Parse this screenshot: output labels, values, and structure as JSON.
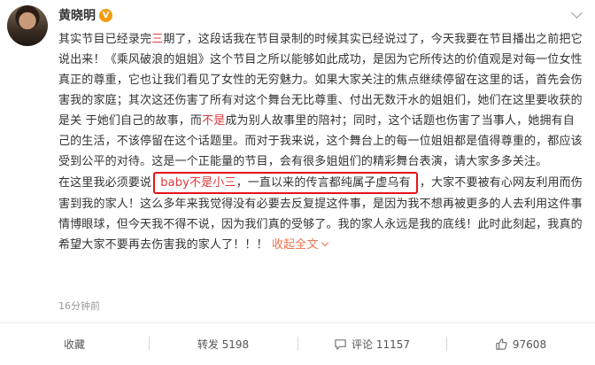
{
  "author": {
    "name": "黄晓明",
    "verified_badge": "V"
  },
  "post": {
    "p1_a": "其实节目已经录完",
    "p1_red": "三",
    "p1_b": "期了，这段话我在节目录制的时候其实已经说过了，今天我要在节目播出之前把它说出来！《乘风破浪的姐姐》这个节目之所以能够如此成功，是因为它所传达的价值观是对每一位女性真正的尊重，它也让我们看见了女性的无穷魅力。如果大家关注的焦点继续停留在这里的话，首先会伤害我的家庭；其次这还伤害了所有对这个舞台无比尊重、付出无数汗水的姐姐们，她们在这里要收获的是关 于她们自己的故事，而",
    "p1_red2": "不是",
    "p1_c": "成为别人故事里的陪衬；同时，这个话题也伤害了当事人，她拥有自己的生活，不该停留在这个话题里。而对于我来说，这个舞台上的每一位姐姐都是值得尊重的，都应该受到公平的对待。这是一个正能量的节目，会有很多姐姐们的精彩舞台表演，请大家多多关注。",
    "p2_a": "在这里我必须要说",
    "p2_red": "baby不是小三",
    "p2_highlight_rest": "，一直以来的传言都纯属子虚乌有",
    "p2_b": "，大家不要被有心网友利用而伤害到我的家人！这么多年来我觉得没有必要去反复提这件事，是因为我不想再被更多的人去利用这件事情博眼球，但今天我不得不说，因为我们真的受够了。我的家人永远是我的底线！此时此刻起，我真的希望大家不要再去伤害我的家人了！！！",
    "expand_label": "收起全文"
  },
  "meta": {
    "timestamp": "16分钟前"
  },
  "actions": {
    "favorite_label": "收藏",
    "repost_label": "转发 5198",
    "comment_label": "评论 11157",
    "like_count": "97608"
  },
  "colors": {
    "accent_red": "#e4393c",
    "link_orange": "#eb7350",
    "verified_orange": "#f39b0f"
  }
}
